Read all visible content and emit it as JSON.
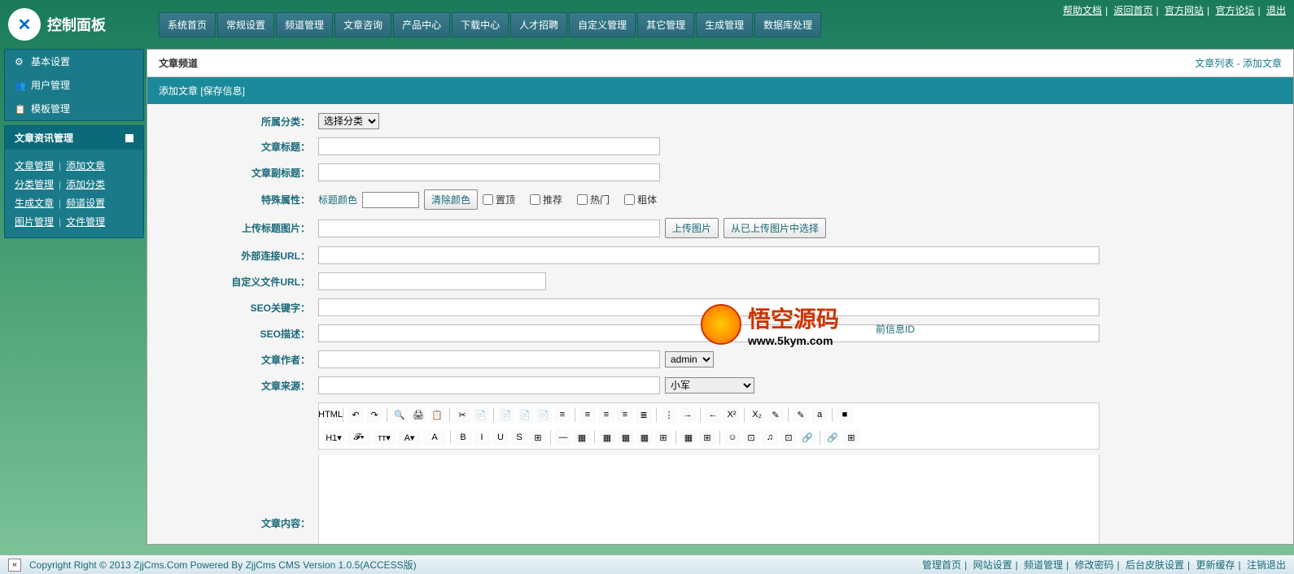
{
  "header": {
    "top_links": [
      "帮助文档",
      "返回首页",
      "官方网站",
      "官方论坛",
      "退出"
    ],
    "logo_text": "控制面板",
    "nav": [
      "系统首页",
      "常规设置",
      "频道管理",
      "文章咨询",
      "产品中心",
      "下载中心",
      "人才招聘",
      "自定义管理",
      "其它管理",
      "生成管理",
      "数据库处理"
    ]
  },
  "sidebar": {
    "box1": [
      {
        "icon": "gear-icon",
        "label": "基本设置"
      },
      {
        "icon": "user-icon",
        "label": "用户管理"
      },
      {
        "icon": "template-icon",
        "label": "模板管理"
      }
    ],
    "section_title": "文章资讯管理",
    "links": [
      [
        "文章管理",
        "添加文章"
      ],
      [
        "分类管理",
        "添加分类"
      ],
      [
        "生成文章",
        "频道设置"
      ],
      [
        "图片管理",
        "文件管理"
      ]
    ]
  },
  "content": {
    "page_title": "文章频道",
    "breadcrumb": {
      "list": "文章列表",
      "sep": " - ",
      "add": "添加文章"
    },
    "section_bar": "添加文章 [保存信息]",
    "form": {
      "category": {
        "label": "所属分类：",
        "select": "选择分类"
      },
      "title": {
        "label": "文章标题："
      },
      "subtitle": {
        "label": "文章副标题："
      },
      "special": {
        "label": "特殊属性：",
        "color_label": "标题颜色",
        "clear_btn": "清除颜色",
        "checks": [
          "置顶",
          "推荐",
          "热门",
          "粗体"
        ]
      },
      "upload_img": {
        "label": "上传标题图片：",
        "btn1": "上传图片",
        "btn2": "从已上传图片中选择"
      },
      "ext_url": {
        "label": "外部连接URL："
      },
      "custom_url": {
        "label": "自定义文件URL：",
        "note": "前信息ID"
      },
      "seo_kw": {
        "label": "SEO关键字："
      },
      "seo_desc": {
        "label": "SEO描述："
      },
      "author": {
        "label": "文章作者：",
        "select": "admin"
      },
      "source": {
        "label": "文章来源：",
        "select": "小军"
      },
      "content": {
        "label": "文章内容："
      }
    },
    "editor_buttons_row1": [
      "HTML",
      "↶",
      "↷",
      "🔍",
      "🖨",
      "📋",
      "✂",
      "📄",
      "📄",
      "📄",
      "📄",
      "≡",
      "≡",
      "≡",
      "≡",
      "≣",
      "⋮",
      "→",
      "←",
      "X²",
      "X₂",
      "✎",
      "✎",
      "a",
      "■"
    ],
    "editor_buttons_row2": [
      "H1▾",
      "𝓕▾",
      "тт▾",
      "A▾",
      "A",
      "B",
      "I",
      "U",
      "S",
      "⊞",
      "—",
      "▦",
      "▦",
      "▦",
      "▦",
      "⊞",
      "▦",
      "⊞",
      "☺",
      "⊡",
      "♫",
      "⊡",
      "🔗",
      "🔗",
      "⊞"
    ]
  },
  "watermark": {
    "title": "悟空源码",
    "url": "www.5kym.com"
  },
  "footer": {
    "copyright": "Copyright Right © 2013 ZjjCms.Com Powered By ZjjCms CMS Version 1.0.5(ACCESS版)",
    "links": [
      "管理首页",
      "网站设置",
      "频道管理",
      "修改密码",
      "后台皮肤设置",
      "更新缓存",
      "注销退出"
    ]
  }
}
